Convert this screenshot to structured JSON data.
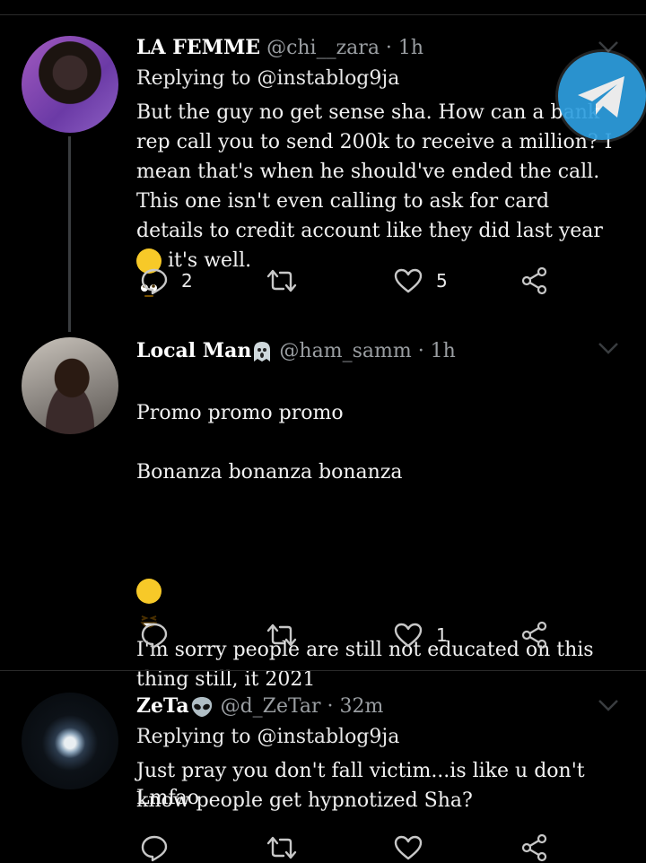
{
  "tweets": [
    {
      "name": "LA FEMME",
      "handle": "@chi__zara · 1h",
      "replying": "Replying to @instablog9ja",
      "text": "But the guy no get sense sha. How can a bank rep call you to send 200k to receive a million? I mean that's when he should've ended the call. This one isn't even calling to ask for card details to credit account like they did last year",
      "text_tail": " it's well.",
      "emoji": "face-with-rolling-eyes",
      "replies": "2",
      "retweets": "",
      "likes": "5"
    },
    {
      "name": "Local Man",
      "name_emoji": "ghost-emoji",
      "handle": "@ham_samm · 1h",
      "line1": "Promo promo promo",
      "line2": "Bonanza bonanza bonanza",
      "emoji": "grinning-squinting-face",
      "line3": "I'm sorry people are still not educated on this thing still, it 2021",
      "line4": "Lmfao",
      "replies": "",
      "retweets": "",
      "likes": "1"
    },
    {
      "name": "ZeTa",
      "name_emoji": "alien-emoji",
      "handle": "@d_ZeTar · 32m",
      "replying": "Replying to @instablog9ja",
      "text": "Just pray you don't fall victim...is like u don't know people get hypnotized Sha?"
    }
  ],
  "colors": {
    "background": "#000000",
    "text": "#ffffff",
    "secondary": "#9a9ea2",
    "telegram": "#2e9fe0"
  }
}
